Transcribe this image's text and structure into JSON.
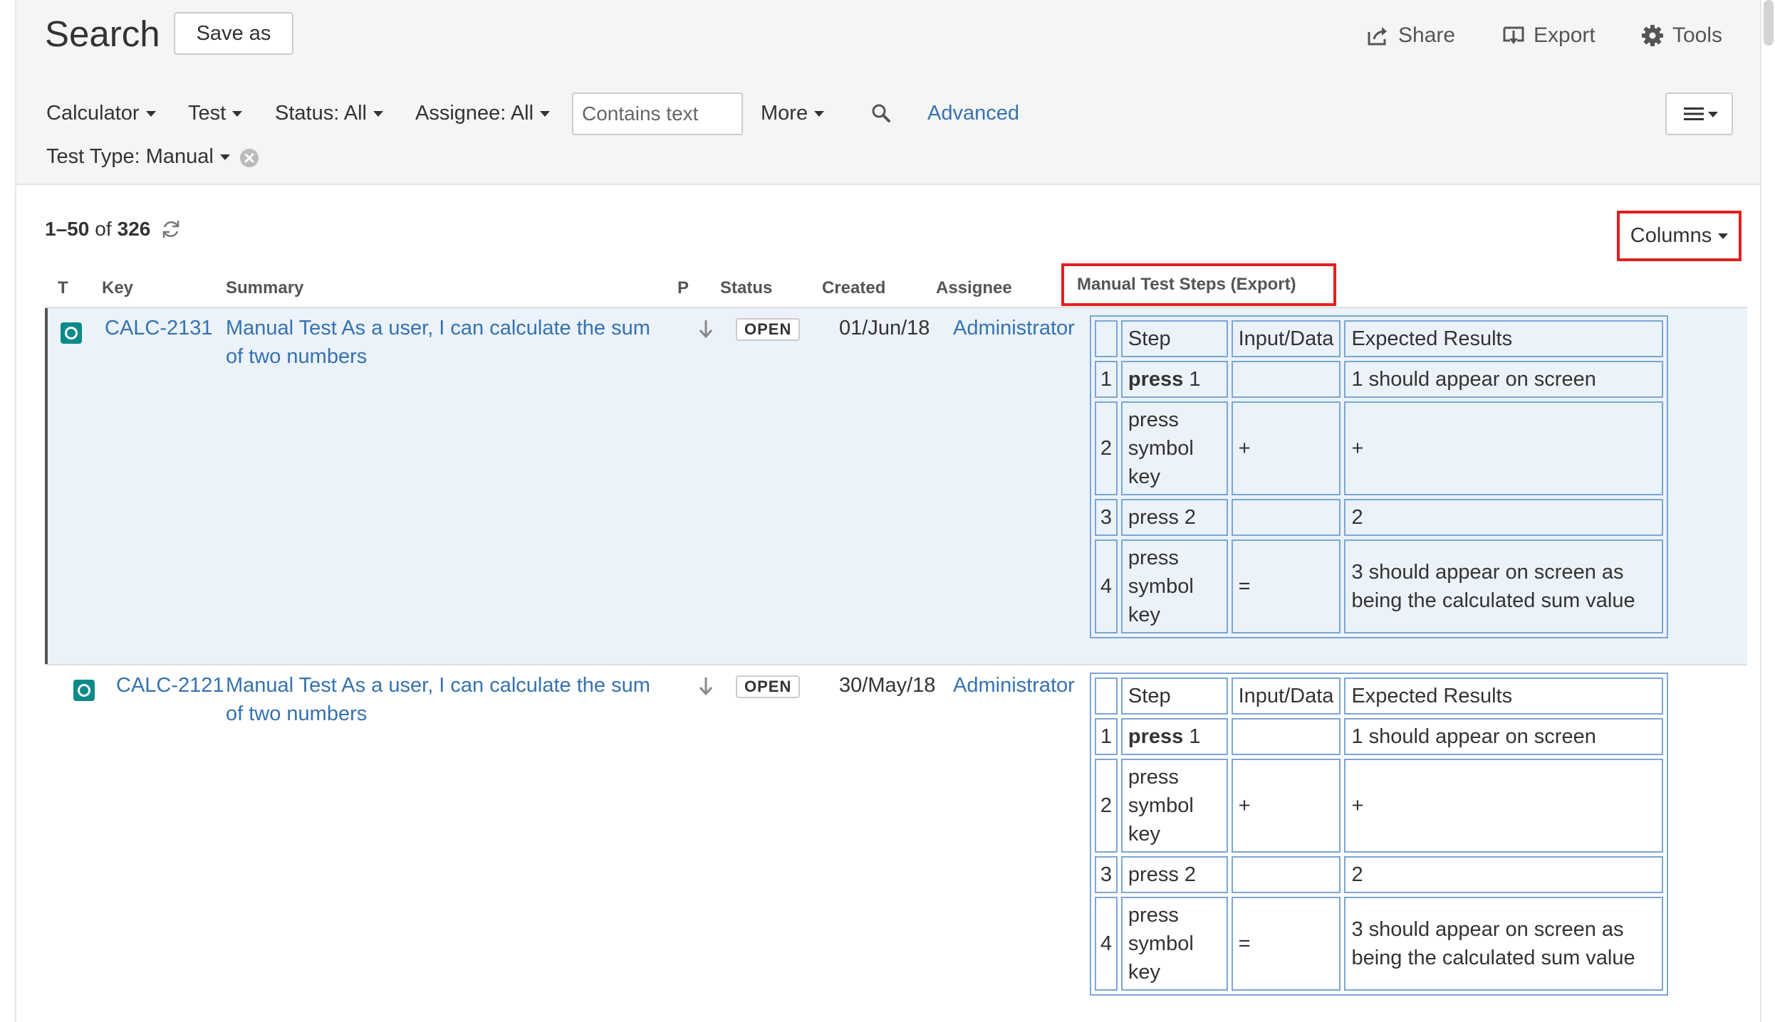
{
  "header": {
    "title": "Search",
    "save_as": "Save as",
    "share": "Share",
    "export": "Export",
    "tools": "Tools"
  },
  "filters": {
    "project": "Calculator",
    "type": "Test",
    "status": "Status: All",
    "assignee": "Assignee: All",
    "text_placeholder": "Contains text",
    "more": "More",
    "advanced": "Advanced",
    "test_type": "Test Type: Manual"
  },
  "results": {
    "range": "1–50",
    "of": "of",
    "total": "326",
    "columns": "Columns"
  },
  "table": {
    "headers": {
      "t": "T",
      "key": "Key",
      "summary": "Summary",
      "p": "P",
      "status": "Status",
      "created": "Created",
      "assignee": "Assignee",
      "steps": "Manual Test Steps (Export)"
    },
    "steps_headers": [
      "",
      "Step",
      "Input/Data",
      "Expected Results"
    ],
    "rows": [
      {
        "key": "CALC-2131",
        "summary": "Manual Test As a user, I can calculate the sum of two numbers",
        "priority_icon": "arrow-down-icon",
        "status": "OPEN",
        "created": "01/Jun/18",
        "assignee": "Administrator",
        "steps": [
          {
            "n": "1",
            "step_bold": "press",
            "step_rest": " 1",
            "input": "",
            "expected": "1 should appear on screen"
          },
          {
            "n": "2",
            "step_bold": "",
            "step_rest": "press symbol key",
            "input": "+",
            "expected": "+"
          },
          {
            "n": "3",
            "step_bold": "",
            "step_rest": "press 2",
            "input": "",
            "expected": "2"
          },
          {
            "n": "4",
            "step_bold": "",
            "step_rest": "press symbol key",
            "input": "=",
            "expected": "3 should appear on screen as being the calculated sum value"
          }
        ]
      },
      {
        "key": "CALC-2121",
        "summary": "Manual Test As a user, I can calculate the sum of two numbers",
        "priority_icon": "arrow-down-icon",
        "status": "OPEN",
        "created": "30/May/18",
        "assignee": "Administrator",
        "steps": [
          {
            "n": "1",
            "step_bold": "press",
            "step_rest": " 1",
            "input": "",
            "expected": "1 should appear on screen"
          },
          {
            "n": "2",
            "step_bold": "",
            "step_rest": "press symbol key",
            "input": "+",
            "expected": "+"
          },
          {
            "n": "3",
            "step_bold": "",
            "step_rest": "press 2",
            "input": "",
            "expected": "2"
          },
          {
            "n": "4",
            "step_bold": "",
            "step_rest": "press symbol key",
            "input": "=",
            "expected": "3 should appear on screen as being the calculated sum value"
          }
        ]
      }
    ]
  },
  "colors": {
    "link": "#3572b0",
    "highlight_box": "#e02020",
    "selected_row": "#ebf2f9",
    "steps_border": "#7ba6d4",
    "issue_type": "#0b8a8a"
  }
}
